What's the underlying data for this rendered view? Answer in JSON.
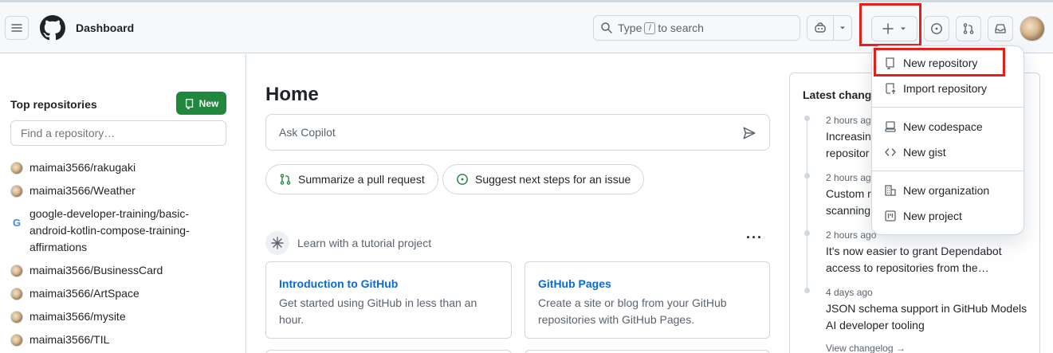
{
  "header": {
    "title": "Dashboard",
    "search_prefix": "Type",
    "search_key": "/",
    "search_suffix": "to search",
    "new_menu_label": "+"
  },
  "sidebar": {
    "heading": "Top repositories",
    "new_button": "New",
    "find_placeholder": "Find a repository…",
    "repos": [
      {
        "name": "maimai3566/rakugaki"
      },
      {
        "name": "maimai3566/Weather"
      },
      {
        "name": "google-developer-training/basic-android-kotlin-compose-training-affirmations",
        "lines": [
          "google-developer-training/basic-",
          "android-kotlin-compose-training-",
          "affirmations"
        ]
      },
      {
        "name": "maimai3566/BusinessCard"
      },
      {
        "name": "maimai3566/ArtSpace"
      },
      {
        "name": "maimai3566/mysite"
      },
      {
        "name": "maimai3566/TIL"
      }
    ]
  },
  "main": {
    "title": "Home",
    "ask_placeholder": "Ask Copilot",
    "pills": [
      {
        "label": "Summarize a pull request"
      },
      {
        "label": "Suggest next steps for an issue"
      }
    ],
    "learn_label": "Learn with a tutorial project",
    "more_label": "···",
    "cards": [
      {
        "title": "Introduction to GitHub",
        "desc_lines": [
          "Get started using GitHub in less than an",
          "hour."
        ]
      },
      {
        "title": "GitHub Pages",
        "desc_lines": [
          "Create a site or blog from your GitHub",
          "repositories with GitHub Pages."
        ]
      }
    ]
  },
  "changelog": {
    "title": "Latest change",
    "items": [
      {
        "time": "2 hours ago",
        "lines": [
          "Increasing",
          "repositor"
        ]
      },
      {
        "time": "2 hours ago",
        "lines": [
          "Custom r",
          "scanning"
        ]
      },
      {
        "time": "2 hours ago",
        "lines": [
          "It's now easier to grant Dependabot",
          "access to repositories from the…"
        ]
      },
      {
        "time": "4 days ago",
        "lines": [
          "JSON schema support in GitHub Models",
          "AI developer tooling"
        ]
      }
    ],
    "view_link": "View changelog →"
  },
  "dropdown": {
    "items": [
      {
        "label": "New repository",
        "icon": "repo-icon"
      },
      {
        "label": "Import repository",
        "icon": "import-icon"
      },
      {
        "label": "New codespace",
        "icon": "codespace-icon"
      },
      {
        "label": "New gist",
        "icon": "code-icon"
      },
      {
        "label": "New organization",
        "icon": "organization-icon"
      },
      {
        "label": "New project",
        "icon": "project-icon"
      }
    ]
  },
  "colors": {
    "primary_green": "#1f883d",
    "link_blue": "#0969da",
    "highlight_red": "#e5201b"
  }
}
